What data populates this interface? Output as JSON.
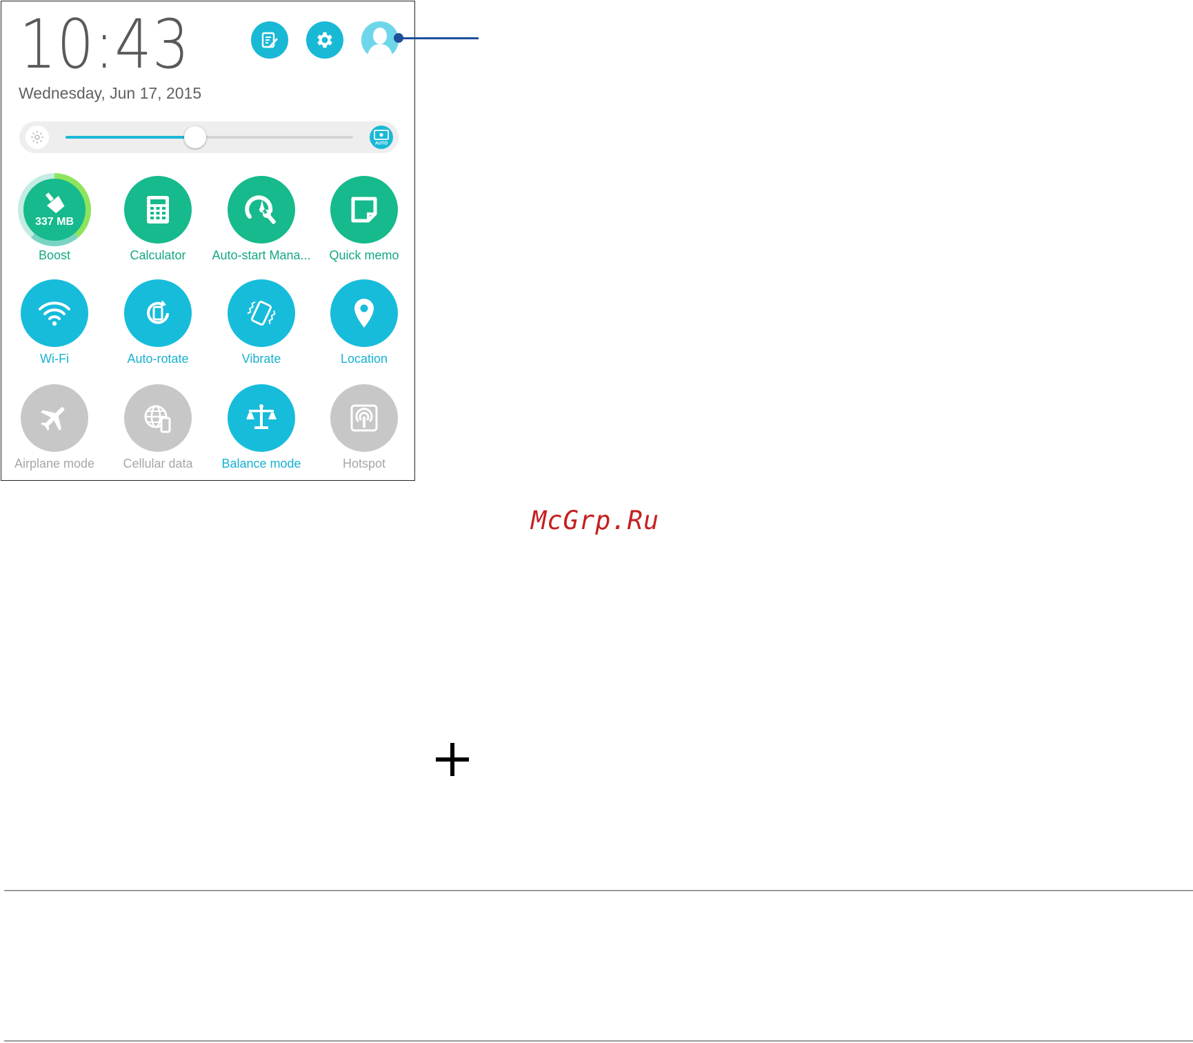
{
  "clock": {
    "time": "10:43",
    "date": "Wednesday, Jun 17, 2015"
  },
  "top_icons": [
    "quick-settings-edit-icon",
    "gear-icon",
    "user-avatar-icon"
  ],
  "brightness": {
    "level": 0.45,
    "min_icon": "sun-icon",
    "auto_icon": "auto-brightness-icon",
    "auto_text": "AUTO"
  },
  "tiles": [
    {
      "label": "Boost",
      "icon": "broom-icon",
      "value": "337 MB",
      "state": "green"
    },
    {
      "label": "Calculator",
      "icon": "calculator-icon",
      "state": "green"
    },
    {
      "label": "Auto-start Mana...",
      "icon": "gauge-wrench-icon",
      "state": "green"
    },
    {
      "label": "Quick memo",
      "icon": "memo-icon",
      "state": "green"
    },
    {
      "label": "Wi-Fi",
      "icon": "wifi-icon",
      "state": "on"
    },
    {
      "label": "Auto-rotate",
      "icon": "auto-rotate-icon",
      "state": "on"
    },
    {
      "label": "Vibrate",
      "icon": "vibrate-icon",
      "state": "on"
    },
    {
      "label": "Location",
      "icon": "location-pin-icon",
      "state": "on"
    },
    {
      "label": "Airplane mode",
      "icon": "airplane-icon",
      "state": "off"
    },
    {
      "label": "Cellular data",
      "icon": "globe-phone-icon",
      "state": "off"
    },
    {
      "label": "Balance mode",
      "icon": "balance-scale-icon",
      "state": "on"
    },
    {
      "label": "Hotspot",
      "icon": "hotspot-icon",
      "state": "off"
    }
  ],
  "watermark": "McGrp.Ru",
  "colors": {
    "accent_blue": "#17bcdb",
    "accent_green": "#16ba8c",
    "disabled_grey": "#c7c7c7",
    "callout": "#1d4f9a",
    "watermark": "#c4201f"
  }
}
